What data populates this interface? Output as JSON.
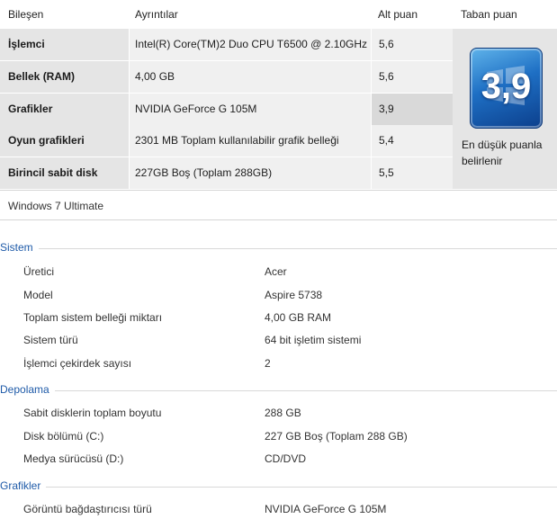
{
  "header": {
    "component": "Bileşen",
    "details": "Ayrıntılar",
    "subscore": "Alt puan",
    "basescore": "Taban puan"
  },
  "rows": [
    {
      "component": "İşlemci",
      "details": "Intel(R) Core(TM)2 Duo CPU T6500 @ 2.10GHz",
      "subscore": "5,6"
    },
    {
      "component": "Bellek (RAM)",
      "details": "4,00 GB",
      "subscore": "5,6"
    },
    {
      "component": "Grafikler",
      "details": "NVIDIA GeForce G 105M",
      "subscore": "3,9"
    },
    {
      "component": "Oyun grafikleri",
      "details": "2301 MB Toplam kullanılabilir grafik belleği",
      "subscore": "5,4"
    },
    {
      "component": "Birincil sabit disk",
      "details": "227GB Boş (Toplam 288GB)",
      "subscore": "5,5"
    }
  ],
  "base_score": {
    "value": "3,9",
    "note": "En düşük puanla belirlenir"
  },
  "os_name": "Windows 7 Ultimate",
  "sections": {
    "system": {
      "title": "Sistem",
      "items": [
        {
          "label": "Üretici",
          "value": "Acer"
        },
        {
          "label": "Model",
          "value": "Aspire 5738"
        },
        {
          "label": "Toplam sistem belleği miktarı",
          "value": "4,00 GB RAM"
        },
        {
          "label": "Sistem türü",
          "value": "64 bit işletim sistemi"
        },
        {
          "label": "İşlemci çekirdek sayısı",
          "value": "2"
        }
      ]
    },
    "storage": {
      "title": "Depolama",
      "items": [
        {
          "label": "Sabit disklerin toplam boyutu",
          "value": "288 GB"
        },
        {
          "label": "Disk bölümü (C:)",
          "value": "227 GB Boş (Toplam 288 GB)"
        },
        {
          "label": "Medya sürücüsü (D:)",
          "value": "CD/DVD"
        }
      ]
    },
    "graphics": {
      "title": "Grafikler",
      "items": [
        {
          "label": "Görüntü bağdaştırıcısı türü",
          "value": "NVIDIA GeForce G 105M"
        }
      ]
    }
  },
  "icons": {
    "badge": "windows-logo-icon"
  },
  "colors": {
    "accent": "#1e5aa8",
    "badge": "#1e6fc4"
  }
}
